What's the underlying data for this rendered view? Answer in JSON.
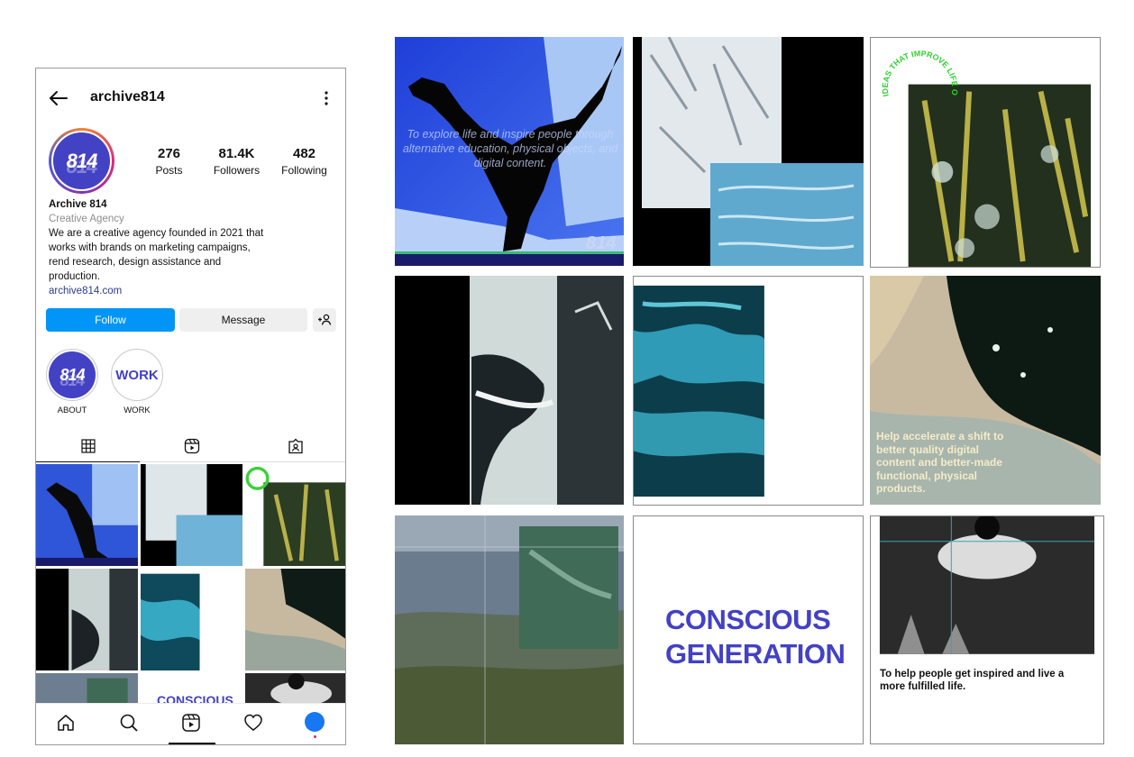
{
  "profile": {
    "username": "archive814",
    "avatar_text": "814",
    "stats": [
      {
        "value": "276",
        "label": "Posts"
      },
      {
        "value": "81.4K",
        "label": "Followers"
      },
      {
        "value": "482",
        "label": "Following"
      }
    ],
    "name": "Archive 814",
    "category": "Creative Agency",
    "bio": "We are a creative agency founded in 2021 that works with brands on marketing campaigns, rend research, design assistance and production.",
    "link": "archive814.com"
  },
  "actions": {
    "follow_label": "Follow",
    "message_label": "Message"
  },
  "highlights": [
    {
      "label": "ABOUT",
      "cover_text": "814"
    },
    {
      "label": "WORK",
      "cover_text": "WORK"
    }
  ],
  "posts": {
    "post1_caption": "To explore life and inspire people through alternative education, physical objects, and digital content.",
    "post1_logo": "814",
    "post3_ring_text": "IDEAS THAT IMPROVE LIFE ON EARTH •",
    "post6_caption": "Help accelerate a shift to better quality digital content and better-made functional, physical products.",
    "post8_caption_line1": "CONSCIOUS",
    "post8_caption_line2": "GENERATION",
    "post9_caption": "To help people get inspired and live a more fulfilled life."
  },
  "colors": {
    "brand_blue": "#4341c4",
    "follow_blue": "#0095f6",
    "button_gray": "#efefef"
  },
  "icons": [
    "back-arrow-icon",
    "more-options-icon",
    "grid-icon",
    "reels-icon",
    "tagged-icon",
    "home-icon",
    "search-icon",
    "reels-nav-icon",
    "heart-icon",
    "add-person-icon"
  ]
}
